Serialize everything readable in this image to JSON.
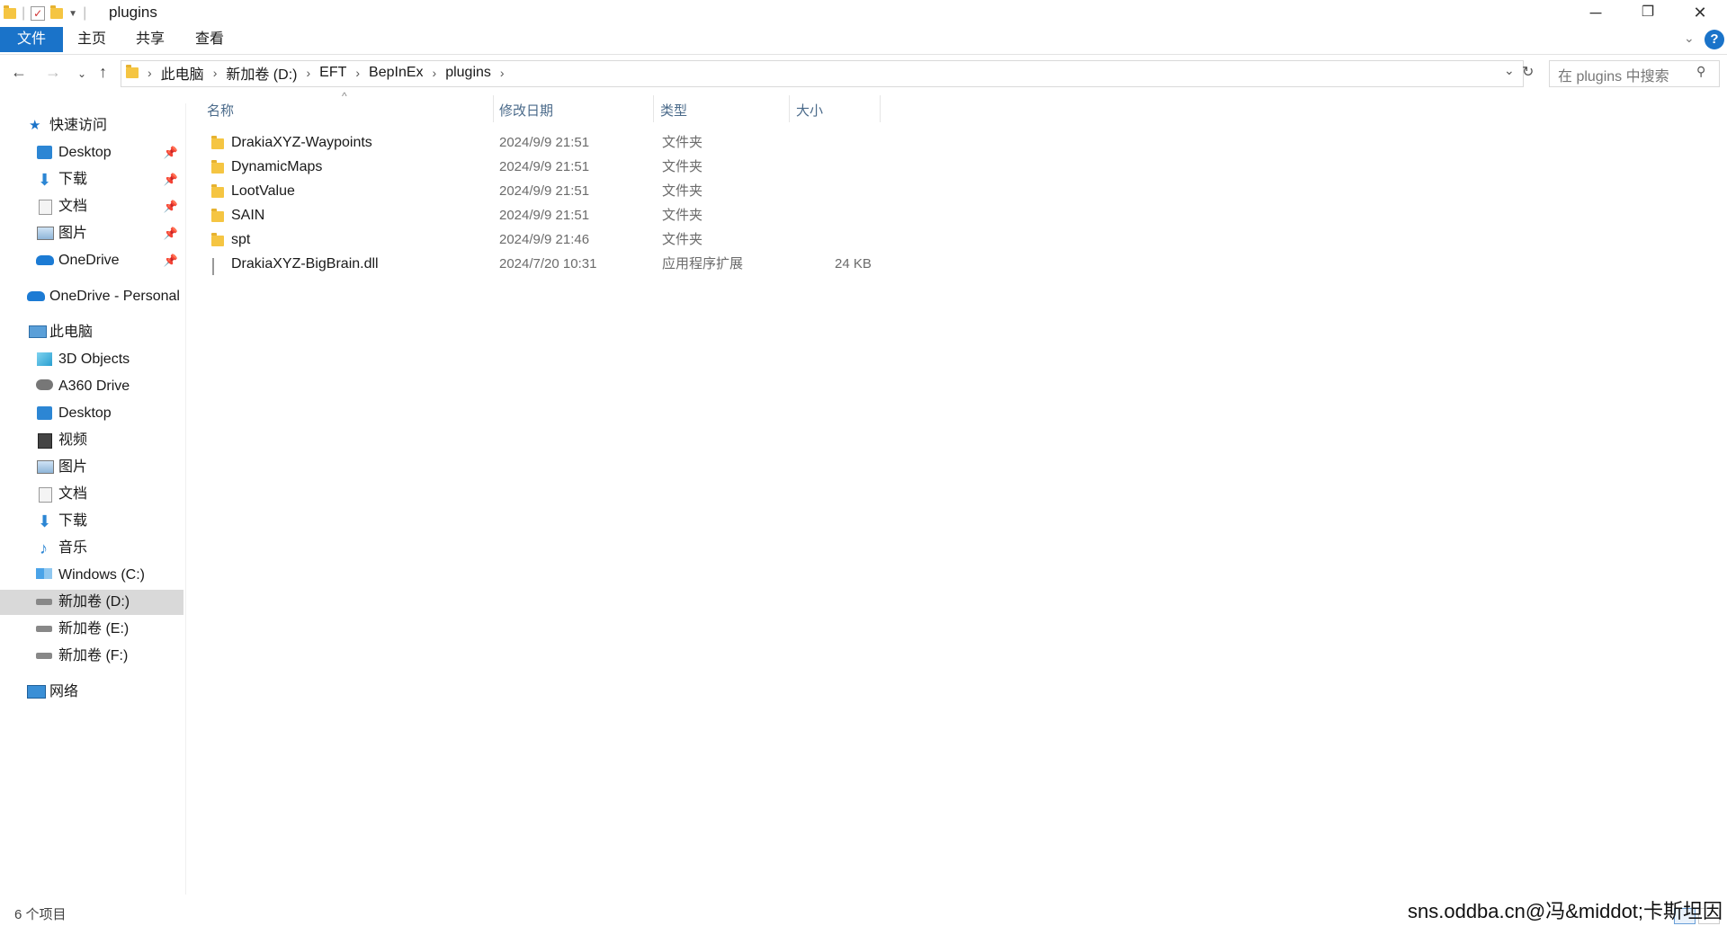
{
  "window": {
    "title": "plugins",
    "controls": {
      "minimize": "─",
      "maximize": "❐",
      "close": "✕"
    }
  },
  "ribbon": {
    "tabs": [
      {
        "label": "文件",
        "active": true
      },
      {
        "label": "主页",
        "active": false
      },
      {
        "label": "共享",
        "active": false
      },
      {
        "label": "查看",
        "active": false
      }
    ],
    "help": "?"
  },
  "address": {
    "crumbs": [
      "此电脑",
      "新加卷 (D:)",
      "EFT",
      "BepInEx",
      "plugins"
    ],
    "search_placeholder": "在 plugins 中搜索"
  },
  "sidebar": {
    "quick_access": {
      "label": "快速访问",
      "items": [
        {
          "label": "Desktop",
          "icon": "desktop-icon",
          "pinned": true
        },
        {
          "label": "下载",
          "icon": "download-icon",
          "pinned": true
        },
        {
          "label": "文档",
          "icon": "document-icon",
          "pinned": true
        },
        {
          "label": "图片",
          "icon": "picture-icon",
          "pinned": true
        },
        {
          "label": "OneDrive",
          "icon": "cloud-icon",
          "pinned": true
        }
      ]
    },
    "onedrive_personal": "OneDrive - Personal",
    "this_pc": {
      "label": "此电脑",
      "items": [
        {
          "label": "3D Objects",
          "icon": "cube-icon"
        },
        {
          "label": "A360 Drive",
          "icon": "a360-icon"
        },
        {
          "label": "Desktop",
          "icon": "desktop-icon"
        },
        {
          "label": "视频",
          "icon": "video-icon"
        },
        {
          "label": "图片",
          "icon": "picture-icon"
        },
        {
          "label": "文档",
          "icon": "document-icon"
        },
        {
          "label": "下载",
          "icon": "download-icon"
        },
        {
          "label": "音乐",
          "icon": "music-icon"
        },
        {
          "label": "Windows (C:)",
          "icon": "windows-drive-icon"
        },
        {
          "label": "新加卷 (D:)",
          "icon": "drive-icon",
          "selected": true
        },
        {
          "label": "新加卷 (E:)",
          "icon": "drive-icon"
        },
        {
          "label": "新加卷 (F:)",
          "icon": "drive-icon"
        }
      ]
    },
    "network": "网络"
  },
  "columns": {
    "name": "名称",
    "modified": "修改日期",
    "type": "类型",
    "size": "大小"
  },
  "files": [
    {
      "name": "DrakiaXYZ-Waypoints",
      "modified": "2024/9/9 21:51",
      "type": "文件夹",
      "size": "",
      "kind": "folder"
    },
    {
      "name": "DynamicMaps",
      "modified": "2024/9/9 21:51",
      "type": "文件夹",
      "size": "",
      "kind": "folder"
    },
    {
      "name": "LootValue",
      "modified": "2024/9/9 21:51",
      "type": "文件夹",
      "size": "",
      "kind": "folder"
    },
    {
      "name": "SAIN",
      "modified": "2024/9/9 21:51",
      "type": "文件夹",
      "size": "",
      "kind": "folder"
    },
    {
      "name": "spt",
      "modified": "2024/9/9 21:46",
      "type": "文件夹",
      "size": "",
      "kind": "folder"
    },
    {
      "name": "DrakiaXYZ-BigBrain.dll",
      "modified": "2024/7/20 10:31",
      "type": "应用程序扩展",
      "size": "24 KB",
      "kind": "file"
    }
  ],
  "status": {
    "count": "6 个项目"
  },
  "watermark": "sns.oddba.cn@冯&middot;卡斯坦因",
  "colors": {
    "accent": "#1a73c9",
    "folder": "#f5c542",
    "selected": "#d9d9d9"
  }
}
